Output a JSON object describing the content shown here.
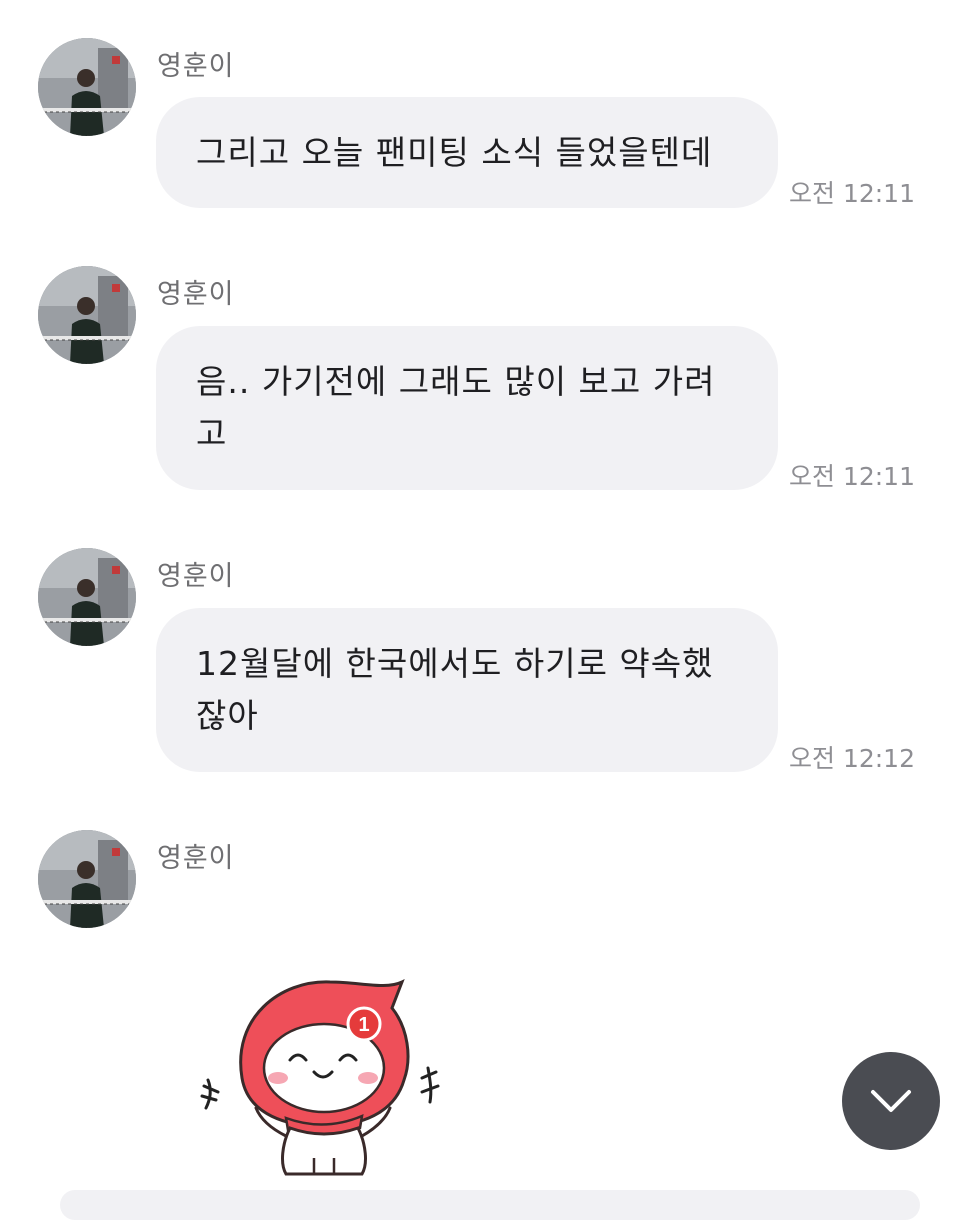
{
  "messages": [
    {
      "sender": "영훈이",
      "text": "그리고 오늘 팬미팅 소식 들었을텐데",
      "time": "오전 12:11"
    },
    {
      "sender": "영훈이",
      "text": "음.. 가기전에 그래도 많이 보고 가려\n고",
      "time": "오전 12:11"
    },
    {
      "sender": "영훈이",
      "text": "12월달에 한국에서도 하기로 약속했\n잖아",
      "time": "오전 12:12"
    },
    {
      "sender": "영훈이",
      "sticker": {
        "icon": "cheering-mascot-sticker",
        "badge": "1"
      }
    }
  ],
  "scroll_button": {
    "icon": "chevron-down-icon"
  },
  "colors": {
    "bubble": "#f1f1f4",
    "text": "#1f1f22",
    "sender": "#6f6f72",
    "time": "#8e8e93",
    "sticker_red": "#ee4f59",
    "scroll_button": "#4a4c52"
  }
}
